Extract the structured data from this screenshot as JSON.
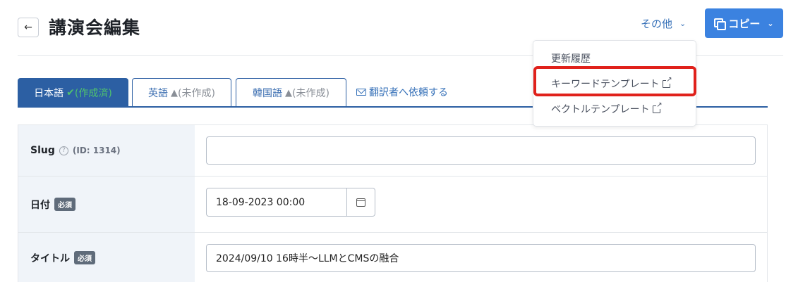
{
  "header": {
    "back_icon": "arrow-left-icon",
    "title": "講演会編集",
    "other_label": "その他",
    "copy_label": "コピー"
  },
  "tabs": [
    {
      "label": "日本語",
      "status": "(作成済)",
      "icon": "check-icon",
      "active": true
    },
    {
      "label": "英語",
      "status": "(未作成)",
      "icon": "warning-icon",
      "active": false
    },
    {
      "label": "韓国語",
      "status": "(未作成)",
      "icon": "warning-icon",
      "active": false
    }
  ],
  "translator_link": "翻訳者へ依頼する",
  "form": {
    "slug": {
      "label": "Slug",
      "id_note": "(ID: 1314)",
      "value": ""
    },
    "date": {
      "label": "日付",
      "required": "必須",
      "value": "18-09-2023 00:00"
    },
    "title": {
      "label": "タイトル",
      "required": "必須",
      "value": "2024/09/10 16時半〜LLMとCMSの融合"
    }
  },
  "dropdown": {
    "items": [
      {
        "label": "更新履歴",
        "external": false
      },
      {
        "label": "キーワードテンプレート",
        "external": true,
        "highlighted": true
      },
      {
        "label": "ベクトルテンプレート",
        "external": true
      }
    ]
  },
  "colors": {
    "accent": "#2c5fa3",
    "primary_button": "#3b82e0",
    "success": "#4fc26e",
    "highlight": "#e0211b"
  }
}
